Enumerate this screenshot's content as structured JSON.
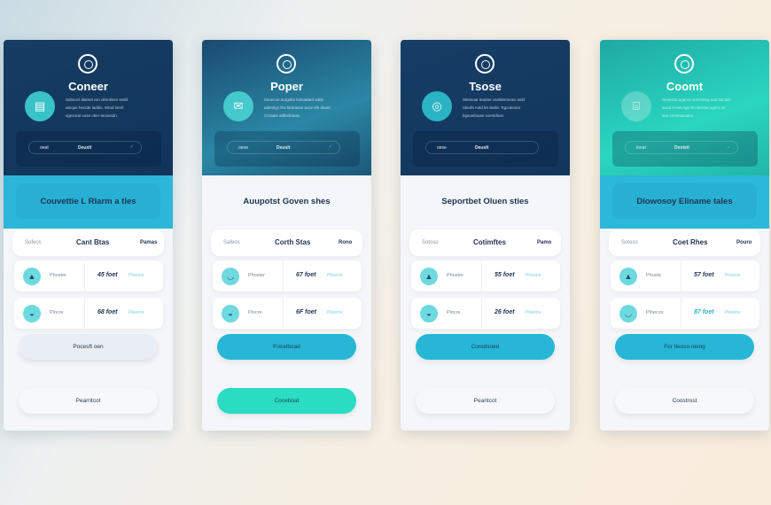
{
  "colors": {
    "navy": "#14385e",
    "cyan": "#27b6d6",
    "green": "#2adcc2",
    "light": "#f4f6fa"
  },
  "cards": [
    {
      "title": "Coneer",
      "avatar_icon": "inbox-icon",
      "avatar_glyph": "▤",
      "description": "Sdasoct dlamet aro olmntises sedd amque hectde laddis. Wtod loerit sgesoral oose ober teosasdn.",
      "menu": {
        "left": "oeat",
        "center": "Deuslt",
        "check": "✓"
      },
      "section_title": "Couvettie L Rlarm a tles",
      "table_header": [
        "Sofeos",
        "Cant Btas",
        "Pamas"
      ],
      "rows": [
        {
          "icon": "sailboat-icon",
          "glyph": "▲",
          "label": "Phoster",
          "value": "45 foet",
          "status": "Plissme"
        },
        {
          "icon": "cup-icon",
          "glyph": "◒",
          "label": "Plocre",
          "value": "68 foet",
          "status": "Plissme"
        }
      ],
      "buttons": [
        "Pocesft oen",
        "Pearritcot"
      ]
    },
    {
      "title": "Poper",
      "avatar_icon": "mail-icon",
      "avatar_glyph": "✉",
      "description": "Ssoecoe aurgsbe ledsadard sdeb ademlyp tho blatrasae acce ele daoer Ceraale adtlsdnteas.",
      "menu": {
        "left": "oeoe",
        "center": "Deuslt",
        "check": "✓"
      },
      "section_title": "Auupotst Goven shes",
      "table_header": [
        "Safeos",
        "Corth Stas",
        "Rono"
      ],
      "rows": [
        {
          "icon": "dish-icon",
          "glyph": "◡",
          "label": "Phoster",
          "value": "67 foet",
          "status": "Plissme"
        },
        {
          "icon": "cup-icon",
          "glyph": "◒",
          "label": "Plocre",
          "value": "6F foet",
          "status": "Plissme"
        }
      ],
      "buttons": [
        "Pocelboad",
        "Coceboat"
      ]
    },
    {
      "title": "Tsose",
      "avatar_icon": "location-icon",
      "avatar_glyph": "◎",
      "description": "Sleesoar leadoe oseldemneso seld rdeoht Aold let dedle. Rgcoteoiar bgsoetlouse soestdsoe.",
      "menu": {
        "left": "oese",
        "center": "Deuslt",
        "check": ""
      },
      "section_title": "Seportbet Oluen sties",
      "table_header": [
        "Sotoso",
        "Cotimftes",
        "Pamo"
      ],
      "rows": [
        {
          "icon": "sailboat-icon",
          "glyph": "▲",
          "label": "Phoster",
          "value": "55 foet",
          "status": "Plissme"
        },
        {
          "icon": "cup-icon",
          "glyph": "◒",
          "label": "Plocre",
          "value": "26 foet",
          "status": "Plissme"
        }
      ],
      "buttons": [
        "Coredsoed",
        "Pearitcot"
      ]
    },
    {
      "title": "Coomt",
      "avatar_icon": "battery-icon",
      "avatar_glyph": "⌸",
      "description": "Seoetcts agaros oresrsiteg aod tsit det aood el eet egs Ro dersiet ogoro on ese ceosrsaosten.",
      "menu": {
        "left": "loeat",
        "center": "Deoteit",
        "check": "⌄"
      },
      "section_title": "Diowosoy Eliname tales",
      "table_header": [
        "Sotoso",
        "Coet Rhes",
        "Pouro"
      ],
      "rows": [
        {
          "icon": "sailboat-icon",
          "glyph": "▲",
          "label": "Phoste",
          "value": "57 foet",
          "status": "Plissme"
        },
        {
          "icon": "dish-icon",
          "glyph": "◡",
          "label": "Plhecos",
          "value": "87 foet",
          "status": "Plissme"
        }
      ],
      "buttons": [
        "For tleoso oeing",
        "Coostrost"
      ]
    }
  ]
}
